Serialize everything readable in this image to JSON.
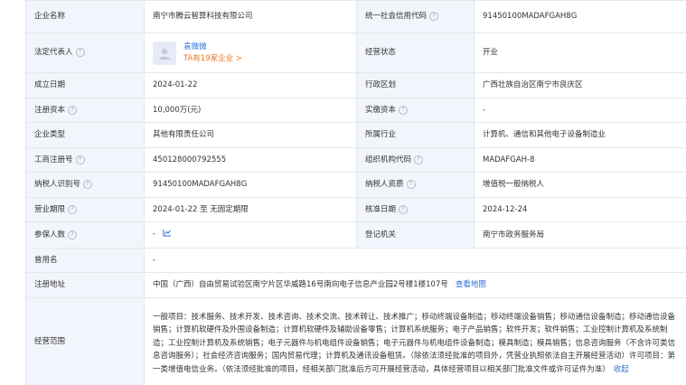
{
  "company": {
    "name_label": "企业名称",
    "name": "南宁市腾云智算科技有限公司",
    "credit_code_label": "统一社会信用代码",
    "credit_code": "91450100MADAFGAH8G",
    "legal_rep_label": "法定代表人",
    "legal_rep_name": "袁微微",
    "legal_rep_companies": "TA有19家企业 >",
    "status_label": "经营状态",
    "status": "开业",
    "founded_label": "成立日期",
    "founded": "2024-01-22",
    "region_label": "行政区划",
    "region": "广西壮族自治区南宁市良庆区",
    "reg_capital_label": "注册资本",
    "reg_capital": "10,000万(元)",
    "paid_capital_label": "实缴资本",
    "paid_capital": "-",
    "type_label": "企业类型",
    "type": "其他有限责任公司",
    "industry_label": "所属行业",
    "industry": "计算机、通信和其他电子设备制造业",
    "biz_reg_no_label": "工商注册号",
    "biz_reg_no": "450128000792555",
    "org_code_label": "组织机构代码",
    "org_code": "MADAFGAH-8",
    "taxpayer_id_label": "纳税人识别号",
    "taxpayer_id": "91450100MADAFGAH8G",
    "taxpayer_qual_label": "纳税人资质",
    "taxpayer_qual": "增值税一般纳税人",
    "biz_term_label": "营业期限",
    "biz_term": "2024-01-22 至 无固定期限",
    "approval_date_label": "核准日期",
    "approval_date": "2024-12-24",
    "insured_label": "参保人数",
    "insured": "-",
    "authority_label": "登记机关",
    "authority": "南宁市政务服务局",
    "former_name_label": "曾用名",
    "former_name": "-",
    "address_label": "注册地址",
    "address": "中国（广西）自由贸易试验区南宁片区华威路16号南向电子信息产业园2号楼1楼107号",
    "map_link": "查看地图",
    "scope_label": "经营范围",
    "scope": "一般项目：技术服务、技术开发、技术咨询、技术交流、技术转让、技术推广；移动终端设备制造；移动终端设备销售；移动通信设备制造；移动通信设备销售；计算机软硬件及外围设备制造；计算机软硬件及辅助设备零售；计算机系统服务；电子产品销售；软件开发；软件销售；工业控制计算机及系统制造；工业控制计算机及系统销售；电子元器件与机电组件设备销售；电子元器件与机电组件设备制造；模具制造；模具销售；信息咨询服务（不含许可类信息咨询服务）；社会经济咨询服务；国内贸易代理；计算机及通讯设备租赁。（除依法须经批准的项目外，凭营业执照依法自主开展经营活动）许可项目：第一类增值电信业务。（依法须经批准的项目，经相关部门批准后方可开展经营活动，具体经营项目以相关部门批准文件或许可证件为准）",
    "collapse_link": "收起"
  },
  "icons": {
    "help": "help-circle-icon",
    "avatar": "user-avatar-icon",
    "chart": "trend-chart-icon"
  },
  "colors": {
    "label_bg": "#f2f5fb",
    "border": "#e5e7ec",
    "link": "#2a6fd6",
    "orange": "#f0761e"
  }
}
